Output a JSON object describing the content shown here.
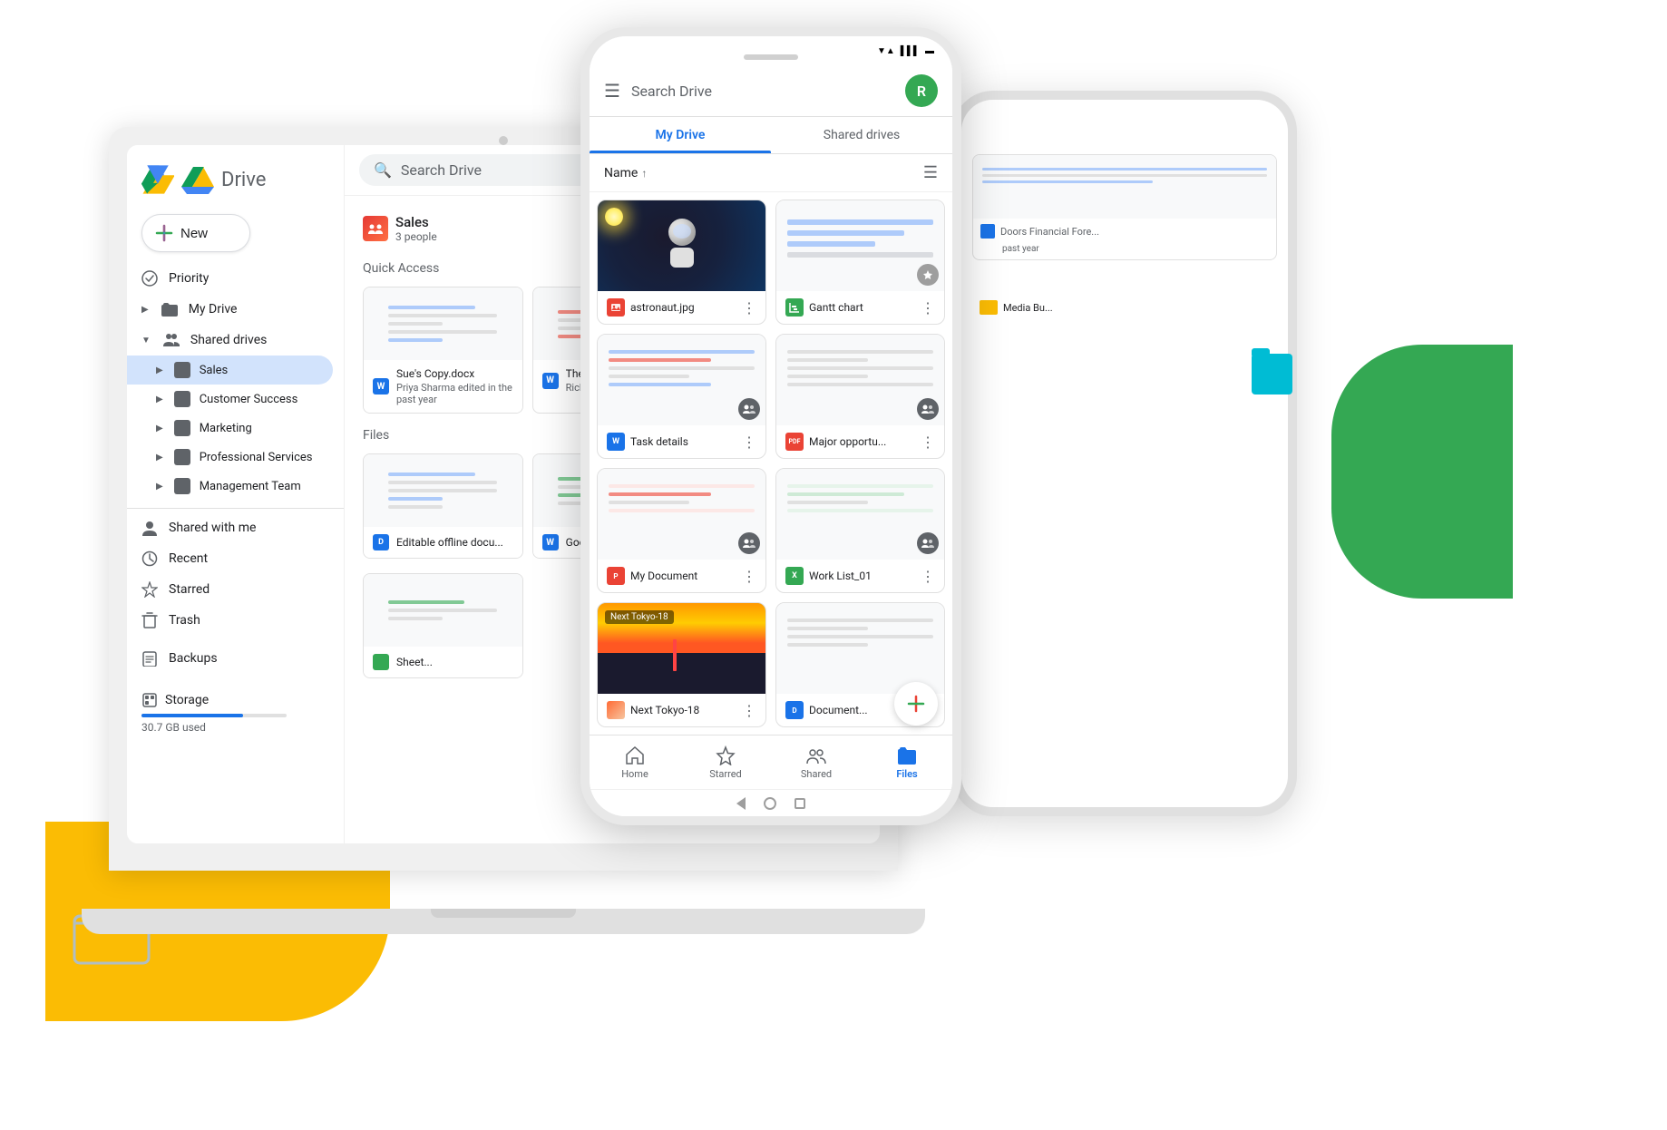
{
  "laptop": {
    "sidebar": {
      "app_name": "Drive",
      "new_button": "New",
      "nav_items": [
        {
          "label": "Priority",
          "icon": "check-circle"
        },
        {
          "label": "My Drive",
          "icon": "folder"
        },
        {
          "label": "Shared drives",
          "icon": "users",
          "expanded": true
        }
      ],
      "shared_drive_items": [
        {
          "label": "Sales",
          "active": true
        },
        {
          "label": "Customer Success"
        },
        {
          "label": "Marketing"
        },
        {
          "label": "Professional Services"
        },
        {
          "label": "Management Team"
        }
      ],
      "bottom_nav": [
        {
          "label": "Shared with me",
          "icon": "person"
        },
        {
          "label": "Recent",
          "icon": "clock"
        },
        {
          "label": "Starred",
          "icon": "star"
        },
        {
          "label": "Trash",
          "icon": "trash"
        }
      ],
      "backups_label": "Backups",
      "storage_label": "Storage",
      "storage_used": "30.7 GB used"
    },
    "main": {
      "search_placeholder": "Search Drive",
      "breadcrumb_title": "Sales",
      "breadcrumb_sub": "3 people",
      "quick_access_label": "Quick Access",
      "files_label": "Files",
      "quick_access_files": [
        {
          "name": "Sue's Copy.docx",
          "edited": "Priya Sharma edited in the past year",
          "icon": "word"
        },
        {
          "name": "The...",
          "edited": "Rich Me...",
          "icon": "word"
        }
      ],
      "files": [
        {
          "name": "Editable offline docu...",
          "icon": "docs"
        },
        {
          "name": "Google...",
          "icon": "word"
        }
      ]
    }
  },
  "phone": {
    "header": {
      "search_placeholder": "Search Drive",
      "avatar_initial": "R"
    },
    "tabs": [
      {
        "label": "My Drive",
        "active": true
      },
      {
        "label": "Shared drives"
      }
    ],
    "sort_label": "Name",
    "files": [
      {
        "name": "astronaut.jpg",
        "type": "image",
        "icon": "image"
      },
      {
        "name": "Gantt chart",
        "type": "sheets",
        "icon": "gantt"
      },
      {
        "name": "Task details",
        "type": "docs",
        "icon": "word"
      },
      {
        "name": "Major opportu...",
        "type": "pdf",
        "icon": "pdf"
      },
      {
        "name": "My Document",
        "type": "slides",
        "icon": "ppt"
      },
      {
        "name": "Work List_01",
        "type": "excel",
        "icon": "excel"
      },
      {
        "name": "Next Tokyo-18",
        "type": "photo",
        "icon": "photo"
      },
      {
        "name": "Document...",
        "type": "docs",
        "icon": "word2"
      }
    ],
    "bottom_nav": [
      {
        "label": "Home",
        "icon": "home",
        "active": false
      },
      {
        "label": "Starred",
        "icon": "star",
        "active": false
      },
      {
        "label": "Shared",
        "icon": "people",
        "active": false
      },
      {
        "label": "Files",
        "icon": "folder",
        "active": true
      }
    ]
  },
  "background_phone": {
    "files": [
      {
        "name": "Doors Financial Fore...",
        "edited": "past year",
        "icon": "docs"
      },
      {
        "name": "Media Bu...",
        "icon": "folder-yellow"
      }
    ]
  }
}
